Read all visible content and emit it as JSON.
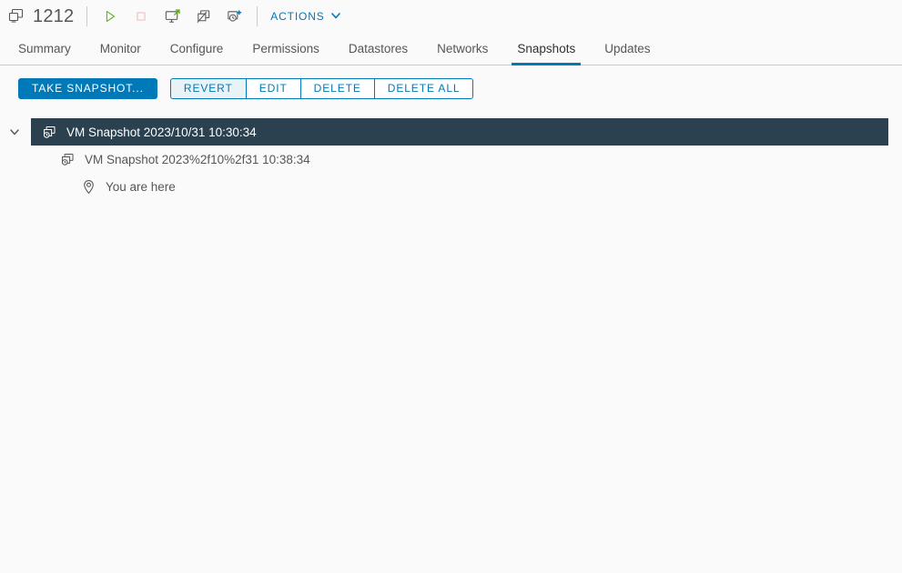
{
  "objectbar": {
    "vm_icon": "virtual-machine-icon",
    "vm_name": "1212",
    "actions": [
      {
        "name": "power-on-icon",
        "title": "Power On"
      },
      {
        "name": "power-off-icon",
        "title": "Power Off"
      },
      {
        "name": "launch-web-console-icon",
        "title": "Launch Web Console"
      },
      {
        "name": "migrate-icon",
        "title": "Migrate"
      },
      {
        "name": "take-snapshot-icon",
        "title": "Take Snapshot"
      }
    ],
    "actions_menu_label": "ACTIONS"
  },
  "tabs": [
    {
      "label": "Summary",
      "active": false
    },
    {
      "label": "Monitor",
      "active": false
    },
    {
      "label": "Configure",
      "active": false
    },
    {
      "label": "Permissions",
      "active": false
    },
    {
      "label": "Datastores",
      "active": false
    },
    {
      "label": "Networks",
      "active": false
    },
    {
      "label": "Snapshots",
      "active": true
    },
    {
      "label": "Updates",
      "active": false
    }
  ],
  "toolbar": {
    "take_snapshot_label": "TAKE SNAPSHOT...",
    "revert_label": "REVERT",
    "edit_label": "EDIT",
    "delete_label": "DELETE",
    "delete_all_label": "DELETE ALL"
  },
  "snapshot_tree": {
    "root": {
      "label": "VM Snapshot 2023/10/31 10:30:34",
      "selected": true,
      "expanded": true
    },
    "child": {
      "label": "VM Snapshot 2023%2f10%2f31 10:38:34"
    },
    "you_are_here": {
      "label": "You are here"
    }
  },
  "colors": {
    "accent_blue": "#0079b8",
    "selected_row": "#2c4150",
    "selected_button_bg": "#e8f2f7",
    "page_bg": "#fafafa",
    "text": "#565656",
    "power_on_green": "#60b515",
    "power_off_red": "#f5c2c2"
  }
}
